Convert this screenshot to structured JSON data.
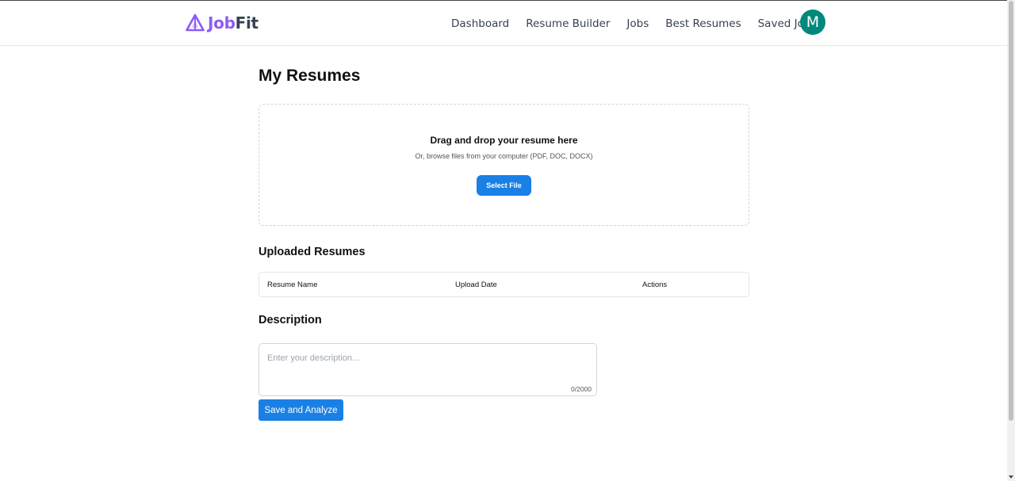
{
  "brand": {
    "part1": "Job",
    "part2": "Fit",
    "logo_icon": "triangle-logo-icon",
    "accent_color": "#8b5cf6"
  },
  "nav": {
    "items": [
      {
        "label": "Dashboard"
      },
      {
        "label": "Resume Builder"
      },
      {
        "label": "Jobs"
      },
      {
        "label": "Best Resumes"
      },
      {
        "label": "Saved Jobs"
      }
    ],
    "avatar_initial": "M",
    "avatar_color": "#00897b"
  },
  "page": {
    "title": "My Resumes"
  },
  "upload": {
    "title": "Drag and drop your resume here",
    "subtitle": "Or, browse files from your computer (PDF, DOC, DOCX)",
    "button_label": "Select File",
    "button_color": "#1a80e5"
  },
  "uploaded": {
    "title": "Uploaded Resumes",
    "columns": [
      "Resume Name",
      "Upload Date",
      "Actions"
    ]
  },
  "description": {
    "title": "Description",
    "placeholder": "Enter your description...",
    "value": "",
    "counter": "0/2000",
    "submit_label": "Save and Analyze"
  }
}
